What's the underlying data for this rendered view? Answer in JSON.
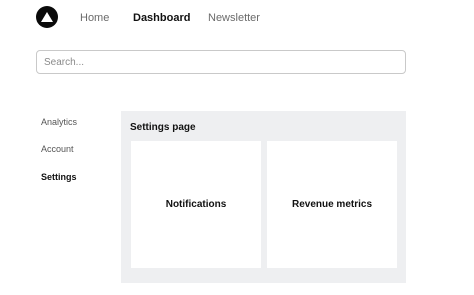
{
  "header": {
    "logo_icon": "triangle-logo-icon",
    "nav": [
      {
        "label": "Home",
        "active": false
      },
      {
        "label": "Dashboard",
        "active": true
      },
      {
        "label": "Newsletter",
        "active": false
      }
    ]
  },
  "search": {
    "placeholder": "Search...",
    "value": ""
  },
  "sidebar": {
    "items": [
      {
        "label": "Analytics",
        "active": false
      },
      {
        "label": "Account",
        "active": false
      },
      {
        "label": "Settings",
        "active": true
      }
    ]
  },
  "main": {
    "title": "Settings page",
    "cards": [
      {
        "label": "Notifications"
      },
      {
        "label": "Revenue metrics"
      }
    ]
  },
  "colors": {
    "panel_bg": "#eeeff1",
    "logo_bg": "#0a0a0a",
    "active_text": "#111111",
    "inactive_text": "#6b6b6b"
  }
}
